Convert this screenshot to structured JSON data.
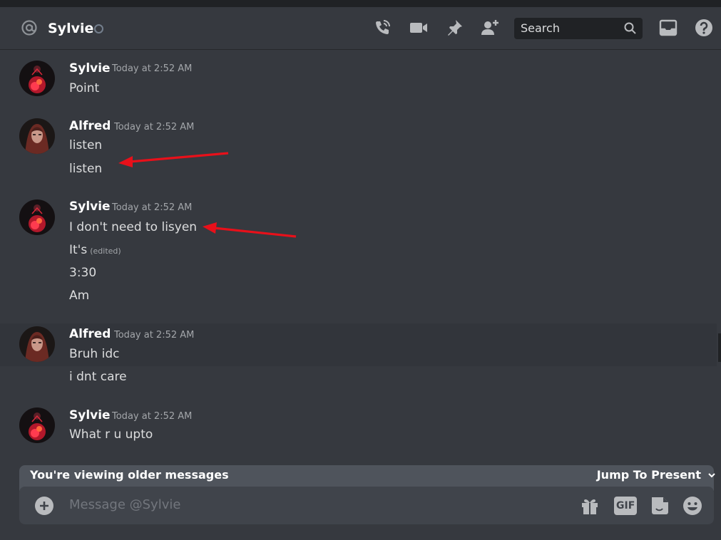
{
  "header": {
    "name": "Sylvie",
    "search_placeholder": "Search"
  },
  "messages": [
    {
      "author": "Sylvie",
      "timestamp": "Today at 2:52 AM",
      "lines": [
        "Point"
      ]
    },
    {
      "author": "Alfred",
      "timestamp": "Today at 2:52 AM",
      "lines": [
        "listen",
        "listen"
      ]
    },
    {
      "author": "Sylvie",
      "timestamp": "Today at 2:52 AM",
      "lines": [
        "I don't need to lisyen",
        "It's",
        "3:30",
        "Am"
      ],
      "edited_label": "(edited)"
    },
    {
      "author": "Alfred",
      "timestamp": "Today at 2:52 AM",
      "lines": [
        "Bruh idc",
        "i dnt care"
      ]
    },
    {
      "author": "Sylvie",
      "timestamp": "Today at 2:52 AM",
      "lines": [
        "What r u upto"
      ]
    }
  ],
  "older_bar": {
    "text": "You're viewing older messages",
    "jump": "Jump To Present"
  },
  "composer": {
    "placeholder": "Message @Sylvie",
    "gif_label": "GIF"
  },
  "colors": {
    "background": "#36393f",
    "annotation_arrow": "#e8101a"
  }
}
